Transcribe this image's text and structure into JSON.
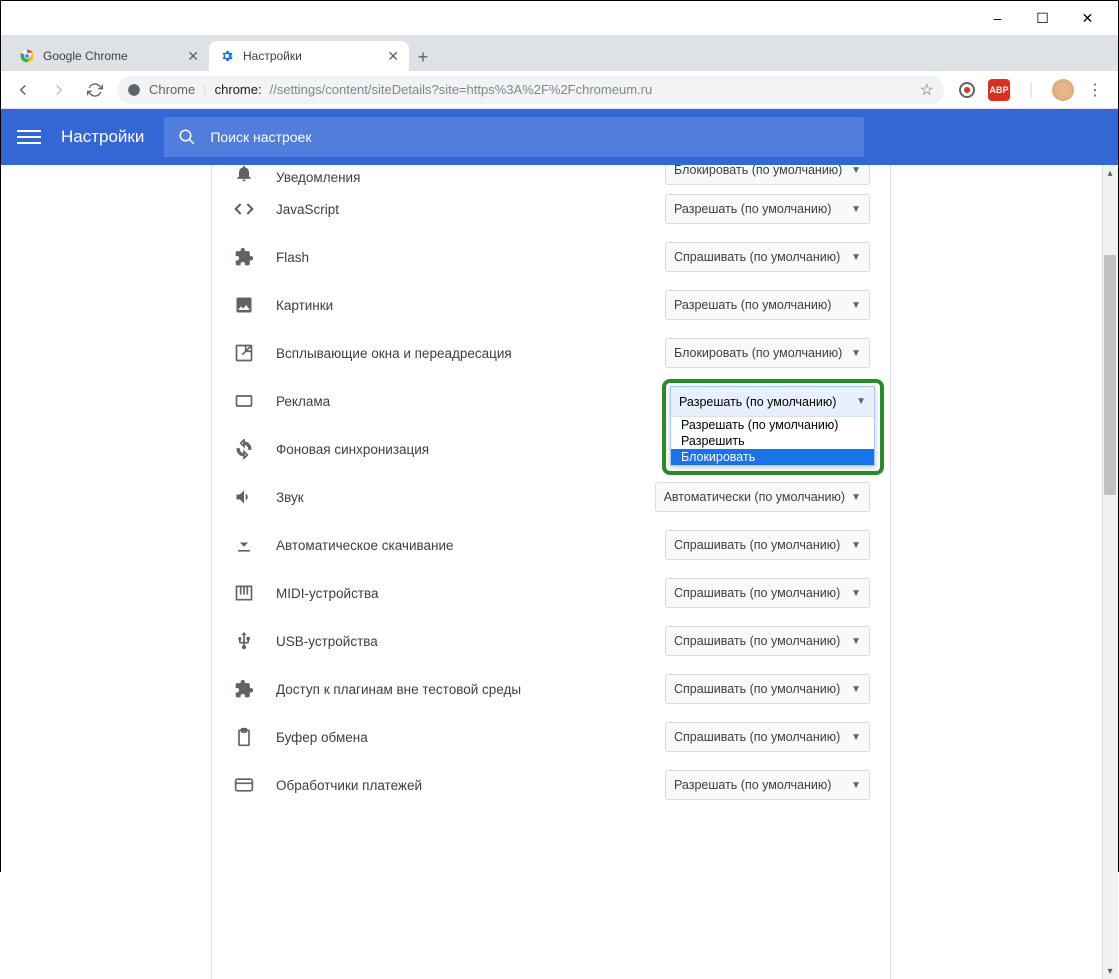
{
  "window": {
    "minimize": "–",
    "maximize": "☐",
    "close": "✕"
  },
  "tabs": {
    "tab1": {
      "label": "Google Chrome"
    },
    "tab2": {
      "label": "Настройки"
    },
    "close": "✕",
    "new": "+"
  },
  "addr": {
    "chip": "Chrome",
    "url_host": "chrome:",
    "url_path": "//settings/content/siteDetails?site=https%3A%2F%2Fchromeum.ru",
    "star": "☆"
  },
  "ext": {
    "abp": "ABP",
    "menu": "⋮"
  },
  "header": {
    "title": "Настройки",
    "search_placeholder": "Поиск настроек"
  },
  "perms": {
    "notifications": {
      "label": "Уведомления",
      "value": "Блокировать (по умолчанию)"
    },
    "javascript": {
      "label": "JavaScript",
      "value": "Разрешать (по умолчанию)"
    },
    "flash": {
      "label": "Flash",
      "value": "Спрашивать (по умолчанию)"
    },
    "images": {
      "label": "Картинки",
      "value": "Разрешать (по умолчанию)"
    },
    "popups": {
      "label": "Всплывающие окна и переадресация",
      "value": "Блокировать (по умолчанию)"
    },
    "ads": {
      "label": "Реклама",
      "value": "Разрешать (по умолчанию)"
    },
    "bgsync": {
      "label": "Фоновая синхронизация"
    },
    "sound": {
      "label": "Звук",
      "value": "Автоматически (по умолчанию)"
    },
    "autodl": {
      "label": "Автоматическое скачивание",
      "value": "Спрашивать (по умолчанию)"
    },
    "midi": {
      "label": "MIDI-устройства",
      "value": "Спрашивать (по умолчанию)"
    },
    "usb": {
      "label": "USB-устройства",
      "value": "Спрашивать (по умолчанию)"
    },
    "plugins": {
      "label": "Доступ к плагинам вне тестовой среды",
      "value": "Спрашивать (по умолчанию)"
    },
    "clipboard": {
      "label": "Буфер обмена",
      "value": "Спрашивать (по умолчанию)"
    },
    "payment": {
      "label": "Обработчики платежей",
      "value": "Разрешать (по умолчанию)"
    }
  },
  "dropdown": {
    "selected": "Разрешать (по умолчанию)",
    "opt1": "Разрешать (по умолчанию)",
    "opt2": "Разрешить",
    "opt3": "Блокировать"
  }
}
